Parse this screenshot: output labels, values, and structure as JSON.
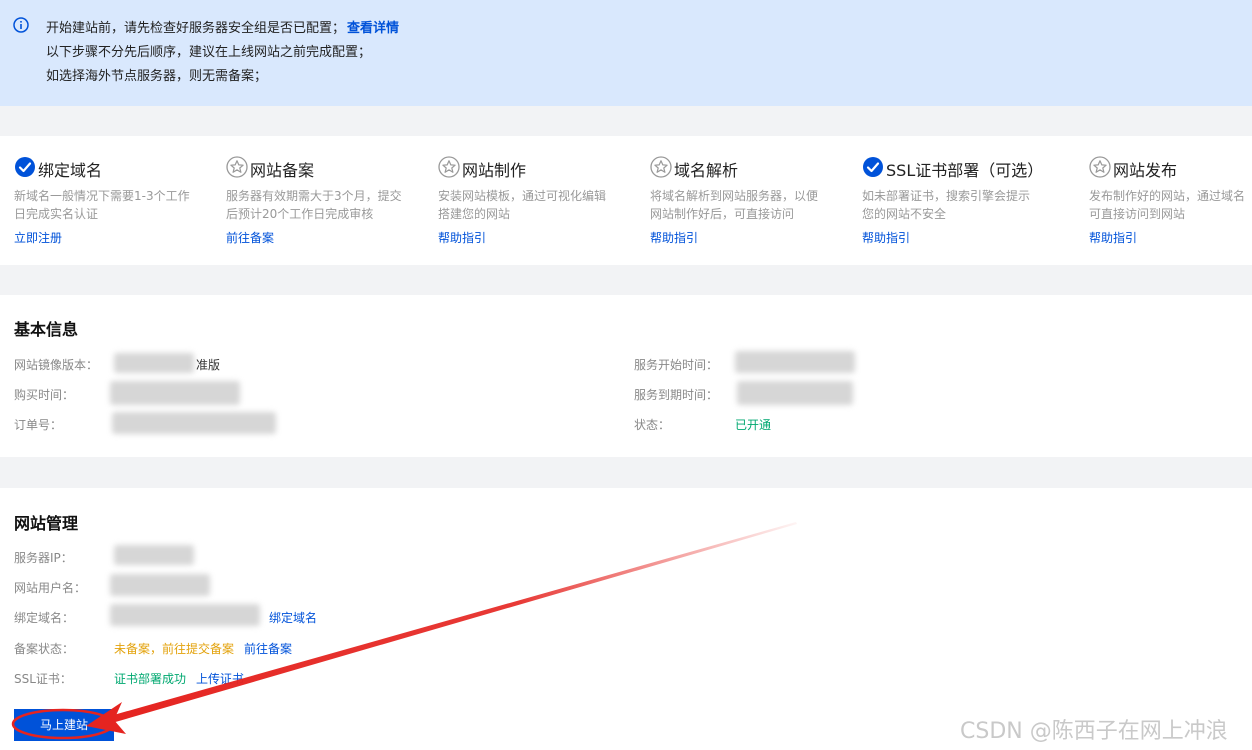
{
  "notice": {
    "line1": "开始建站前，请先检查好服务器安全组是否已配置；",
    "detail_link": "查看详情",
    "line2": "以下步骤不分先后顺序，建议在上线网站之前完成配置；",
    "line3": "如选择海外节点服务器，则无需备案；"
  },
  "steps": [
    {
      "title": "绑定域名",
      "status": "done",
      "desc": "新域名一般情况下需要1-3个工作日完成实名认证",
      "link": "立即注册"
    },
    {
      "title": "网站备案",
      "status": "todo",
      "desc": "服务器有效期需大于3个月，提交后预计20个工作日完成审核",
      "link": "前往备案"
    },
    {
      "title": "网站制作",
      "status": "todo",
      "desc": "安装网站模板，通过可视化编辑搭建您的网站",
      "link": "帮助指引"
    },
    {
      "title": "域名解析",
      "status": "todo",
      "desc": "将域名解析到网站服务器，以便网站制作好后，可直接访问",
      "link": "帮助指引"
    },
    {
      "title": "SSL证书部署（可选）",
      "status": "done",
      "desc": "如未部署证书，搜索引擎会提示您的网站不安全",
      "link": "帮助指引"
    },
    {
      "title": "网站发布",
      "status": "todo",
      "desc": "发布制作好的网站，通过域名可直接访问到网站",
      "link": "帮助指引"
    }
  ],
  "basic": {
    "title": "基本信息",
    "image_version_label": "网站镜像版本：",
    "image_version_value": "准版",
    "purchase_time_label": "购买时间：",
    "order_no_label": "订单号：",
    "service_start_label": "服务开始时间：",
    "service_end_label": "服务到期时间：",
    "status_label": "状态：",
    "status_value": "已开通"
  },
  "site": {
    "title": "网站管理",
    "server_ip_label": "服务器IP：",
    "username_label": "网站用户名：",
    "bind_domain_label": "绑定域名：",
    "bind_domain_link": "绑定域名",
    "icp_label": "备案状态：",
    "icp_status": "未备案，前往提交备案",
    "icp_link": "前往备案",
    "ssl_label": "SSL证书：",
    "ssl_status": "证书部署成功",
    "ssl_link": "上传证书",
    "build_button": "马上建站"
  },
  "watermark": "CSDN @陈西子在网上冲浪",
  "colors": {
    "primary": "#0052d9",
    "success": "#00a870",
    "warning": "#e3a20b",
    "annotation_red": "#e52420"
  },
  "icons": {
    "done": "check-circle-icon",
    "todo": "star-circle-icon",
    "notice": "info-icon"
  }
}
